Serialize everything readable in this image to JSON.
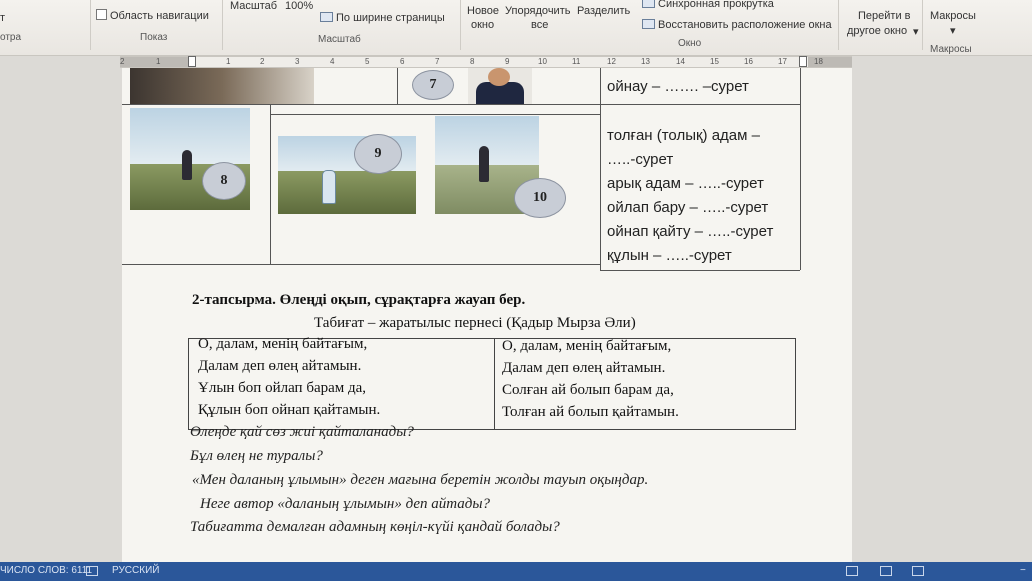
{
  "ribbon": {
    "partial_left_top": "т",
    "partial_left_bottom": "отра",
    "nav_pane_label": "Область навигации",
    "show_group": "Показ",
    "zoom_label": "Масштаб",
    "zoom_percent": "100%",
    "page_width_label": "По ширине страницы",
    "zoom_group": "Масштаб",
    "new_window_1": "Новое",
    "new_window_2": "окно",
    "arrange_1": "Упорядочить",
    "arrange_2": "все",
    "split": "Разделить",
    "sync_scroll": "Синхронная прокрутка",
    "reset_position": "Восстановить расположение окна",
    "window_group": "Окно",
    "switch_1": "Перейти в",
    "switch_2": "другое окно",
    "macros": "Макросы",
    "macros_group": "Макросы"
  },
  "ruler": {
    "ticks": [
      "2",
      "1",
      "1",
      "2",
      "3",
      "4",
      "5",
      "6",
      "7",
      "8",
      "9",
      "10",
      "11",
      "12",
      "13",
      "14",
      "15",
      "16",
      "17",
      "18"
    ]
  },
  "image_numbers": [
    "7",
    "8",
    "9",
    "10"
  ],
  "suret_items": [
    "ойнау – ……. –сурет",
    "толған (толық) адам –",
    "…..-сурет",
    "арық адам – …..-сурет",
    "ойлап бару – …..-сурет",
    "ойнап қайту – …..-сурет",
    "құлын – …..-сурет"
  ],
  "task": {
    "heading": "2-тапсырма. Өлеңді оқып, сұрақтарға жауап бер.",
    "poem_title": "Табиғат – жаратылыс пернесі (Қадыр Мырза Әли)"
  },
  "poem": {
    "left": [
      "О, далам, менің байтағым,",
      "Далам деп өлең айтамын.",
      "Ұлын боп ойлап барам да,",
      "Құлын боп ойнап қайтамын."
    ],
    "right": [
      "О, далам, менің байтағым,",
      "Далам деп өлең айтамын.",
      "Солған ай болып барам да,",
      "Толған ай болып қайтамын."
    ]
  },
  "questions": [
    "Өлеңде қай сөз жиі қайталанады?",
    "Бұл өлең не туралы?",
    "«Мен даланың ұлымын» деген мағына беретін жолды тауып оқыңдар.",
    "Неге автор «даланың ұлымын» деп айтады?",
    "Табиғатта демалған адамның көңіл-күйі қандай болады?"
  ],
  "status": {
    "word_count": "ЧИСЛО СЛОВ: 6111",
    "language": "РУССКИЙ"
  }
}
